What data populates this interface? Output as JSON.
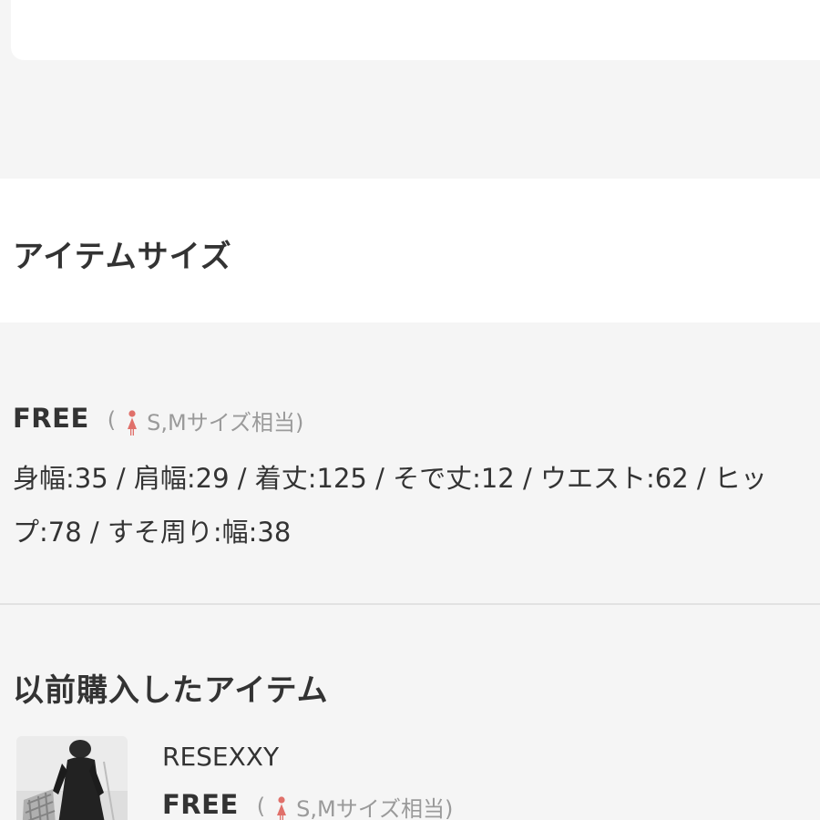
{
  "item_size": {
    "heading": "アイテムサイズ",
    "size_name": "FREE",
    "note_open": "(",
    "note_text": "S,Mサイズ相当)",
    "measure_line1": "身幅:35 / 肩幅:29 / 着丈:125 / そで丈:12 / ウエスト:62 / ヒッ",
    "measure_line2": "プ:78 / すそ周り:幅:38"
  },
  "previous_purchases": {
    "heading": "以前購入したアイテム",
    "items": [
      {
        "brand": "RESEXXY",
        "size_name": "FREE",
        "note_open": "(",
        "note_text": "S,Mサイズ相当)"
      }
    ]
  },
  "colors": {
    "icon_accent": "#e0706a",
    "muted_text": "#9a9a9a",
    "primary_text": "#333333"
  },
  "icons": {
    "size_person": "person-silhouette-icon"
  }
}
